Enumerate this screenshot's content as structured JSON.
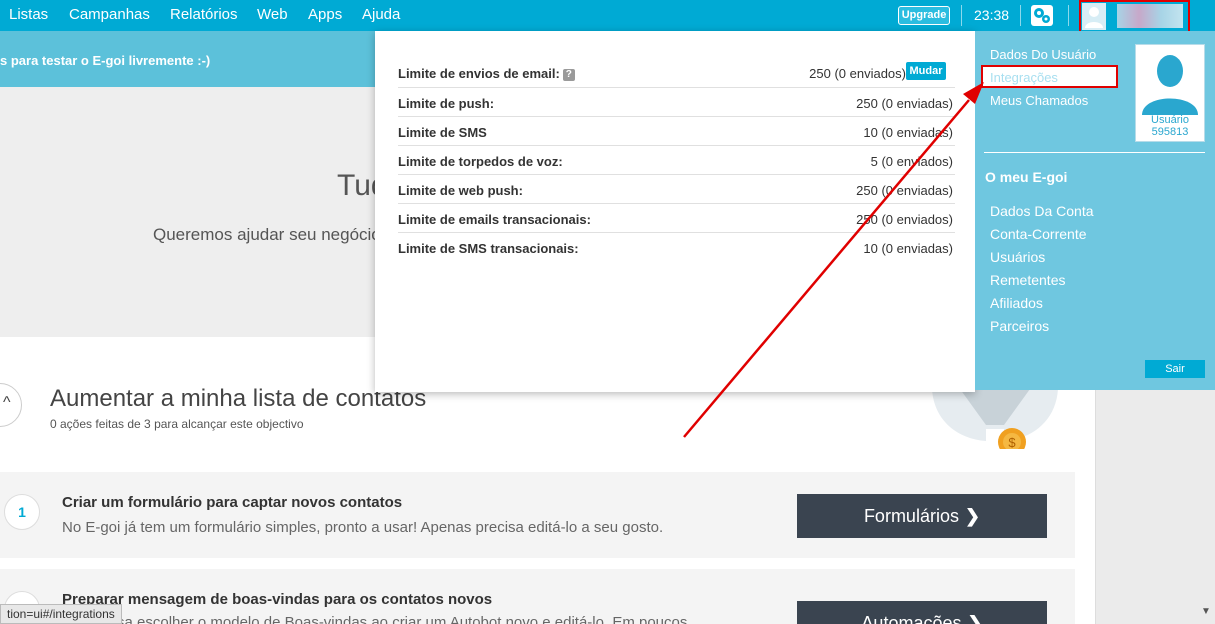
{
  "nav": {
    "items": [
      "Listas",
      "Campanhas",
      "Relatórios",
      "Web",
      "Apps",
      "Ajuda"
    ],
    "upgrade_label": "Upgrade",
    "time": "23:38"
  },
  "banner": {
    "text": "s para testar o E-goi livremente :-)"
  },
  "hero": {
    "title": "Tudo",
    "subtitle": "Queremos ajudar seu negócio"
  },
  "goal": {
    "title": "Aumentar a minha lista de contatos",
    "subtitle": "0 ações feitas de 3 para alcançar este objectivo"
  },
  "steps": [
    {
      "number": "1",
      "title": "Criar um formulário para captar novos contatos",
      "description": "No E-goi já tem um formulário simples, pronto a usar! Apenas precisa editá-lo a seu gosto.",
      "button": "Formulários"
    },
    {
      "number": "",
      "title": "Preparar mensagem de boas-vindas para os contatos novos",
      "description": "Só precisa escolher o modelo de Boas-vindas ao criar um Autobot novo e editá-lo. Em poucos",
      "button": "Automações"
    }
  ],
  "limits": {
    "rows": [
      {
        "label": "Limite de envios de email:",
        "value": "250 (0 enviados)"
      },
      {
        "label": "Limite de push:",
        "value": "250 (0 enviadas)"
      },
      {
        "label": "Limite de SMS",
        "value": "10 (0 enviadas)"
      },
      {
        "label": "Limite de torpedos de voz:",
        "value": "5 (0 enviados)"
      },
      {
        "label": "Limite de web push:",
        "value": "250 (0 enviadas)"
      },
      {
        "label": "Limite de emails transacionais:",
        "value": "250 (0 enviados)"
      },
      {
        "label": "Limite de SMS transacionais:",
        "value": "10 (0 enviadas)"
      }
    ],
    "help_glyph": "?",
    "change_label": "Mudar"
  },
  "user_menu": {
    "links": [
      "Dados Do Usuário",
      "Integrações",
      "Meus Chamados"
    ],
    "avatar_caption": "Usuário",
    "user_id": "595813",
    "section_title": "O meu E-goi",
    "account_links": [
      "Dados Da Conta",
      "Conta-Corrente",
      "Usuários",
      "Remetentes",
      "Afiliados",
      "Parceiros"
    ],
    "logout_label": "Sair"
  },
  "status_bar": {
    "url": "tion=ui#/integrations"
  },
  "icons": {
    "chevron": "❯",
    "collapse": "^",
    "scroll_down": "▼"
  },
  "colors": {
    "brand": "#00aad4",
    "menu": "#6fc7e0",
    "highlight": "#e00000",
    "button_dark": "#3a4450"
  }
}
